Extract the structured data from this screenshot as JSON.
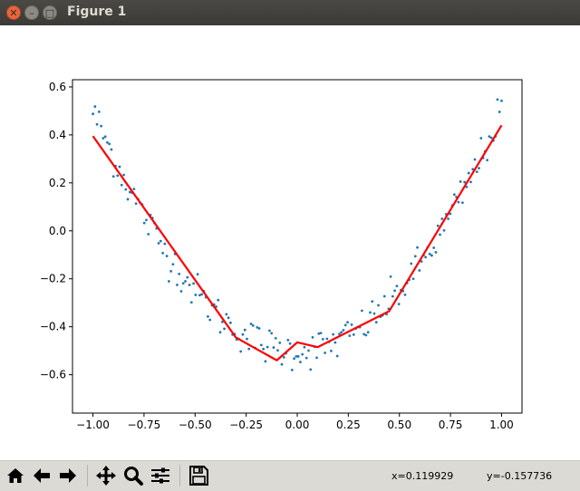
{
  "window": {
    "title": "Figure 1"
  },
  "toolbar": {
    "buttons": [
      "home-icon",
      "back-arrow-icon",
      "forward-arrow-icon",
      "pan-icon",
      "zoom-icon",
      "subplots-icon",
      "save-icon"
    ],
    "x_readout": "x=0.119929",
    "y_readout": "y=-0.157736"
  },
  "colors": {
    "scatter": "#1f77b4",
    "line": "#ff0000",
    "titlebar": "#3c3b37",
    "toolbar": "#dcdad5"
  },
  "chart_data": {
    "type": "scatter",
    "title": "",
    "xlabel": "",
    "ylabel": "",
    "xlim": [
      -1.1,
      1.1
    ],
    "ylim": [
      -0.76,
      0.63
    ],
    "xticks": [
      -1.0,
      -0.75,
      -0.5,
      -0.25,
      0.0,
      0.25,
      0.5,
      0.75,
      1.0
    ],
    "xtick_labels": [
      "−1.00",
      "−0.75",
      "−0.50",
      "−0.25",
      "0.00",
      "0.25",
      "0.50",
      "0.75",
      "1.00"
    ],
    "yticks": [
      -0.6,
      -0.4,
      -0.2,
      0.0,
      0.2,
      0.4,
      0.6
    ],
    "ytick_labels": [
      "−0.6",
      "−0.4",
      "−0.2",
      "0.0",
      "0.2",
      "0.4",
      "0.6"
    ],
    "grid": false,
    "scatter_series": {
      "x_start": -1.0,
      "x_end": 1.0,
      "n_points": 200,
      "approx_curve": "y ≈ x² − 0.5 plus noise",
      "noise_std": 0.04
    },
    "line_series": {
      "x": [
        -1.0,
        -0.3,
        -0.1,
        0.0,
        0.1,
        0.45,
        1.0
      ],
      "y": [
        0.395,
        -0.445,
        -0.54,
        -0.465,
        -0.485,
        -0.335,
        0.44
      ]
    }
  }
}
